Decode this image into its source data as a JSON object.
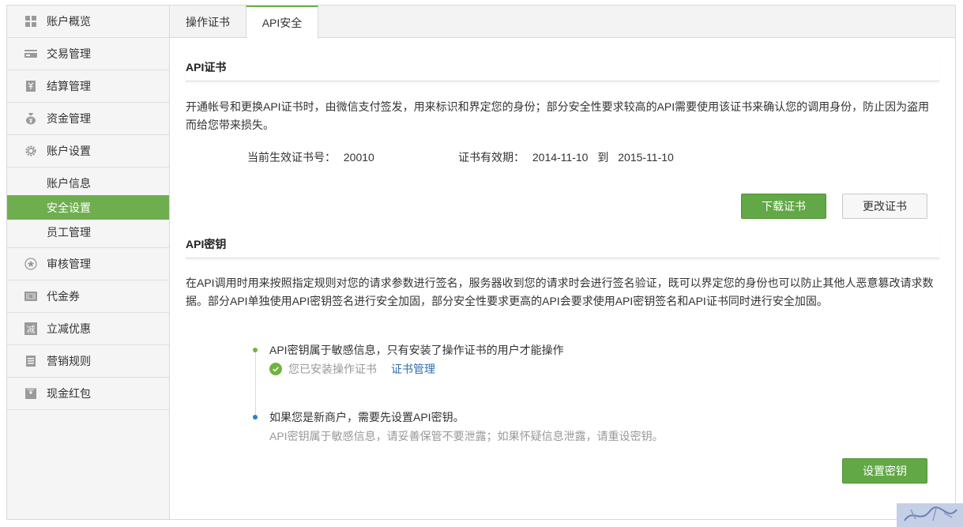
{
  "sidebar": {
    "items": [
      {
        "label": "账户概览",
        "icon": "grid-icon"
      },
      {
        "label": "交易管理",
        "icon": "card-icon"
      },
      {
        "label": "结算管理",
        "icon": "receipt-icon"
      },
      {
        "label": "资金管理",
        "icon": "money-bag-icon"
      },
      {
        "label": "账户设置",
        "icon": "gear-icon"
      }
    ],
    "sub_items": [
      {
        "label": "账户信息"
      },
      {
        "label": "安全设置",
        "active": true
      },
      {
        "label": "员工管理"
      }
    ],
    "items_after": [
      {
        "label": "审核管理",
        "icon": "star-icon"
      },
      {
        "label": "代金券",
        "icon": "coupon-icon"
      },
      {
        "label": "立减优惠",
        "icon": "discount-icon"
      },
      {
        "label": "营销规则",
        "icon": "document-icon"
      },
      {
        "label": "现金红包",
        "icon": "red-packet-icon"
      }
    ]
  },
  "tabs": [
    {
      "label": "操作证书"
    },
    {
      "label": "API安全",
      "active": true
    }
  ],
  "cert": {
    "title": "API证书",
    "description": "开通帐号和更换API证书时，由微信支付签发，用来标识和界定您的身份；部分安全性要求较高的API需要使用该证书来确认您的调用身份，防止因为盗用而给您带来损失。",
    "serial_label": "当前生效证书号：",
    "serial_value": "20010",
    "validity_label": "证书有效期：",
    "validity_start": "2014-11-10",
    "validity_to": "到",
    "validity_end": "2015-11-10",
    "download_button": "下载证书",
    "change_button": "更改证书"
  },
  "key": {
    "title": "API密钥",
    "description": "在API调用时用来按照指定规则对您的请求参数进行签名，服务器收到您的请求时会进行签名验证，既可以界定您的身份也可以防止其他人恶意篡改请求数据。部分API单独使用API密钥签名进行安全加固，部分安全性要求更高的API会要求使用API密钥签名和API证书同时进行安全加固。",
    "step1_text": "API密钥属于敏感信息，只有安装了操作证书的用户才能操作",
    "step1_status": "您已安装操作证书",
    "step1_link": "证书管理",
    "step2_text": "如果您是新商户，需要先设置API密钥。",
    "step2_note": "API密钥属于敏感信息，请妥善保管不要泄露；如果怀疑信息泄露，请重设密钥。",
    "set_button": "设置密钥"
  },
  "colors": {
    "accent_green": "#6fae4f",
    "button_green": "#62a846",
    "dot_green": "#6fb43f",
    "dot_blue": "#2f7fc8",
    "link_blue": "#2f6fad"
  }
}
